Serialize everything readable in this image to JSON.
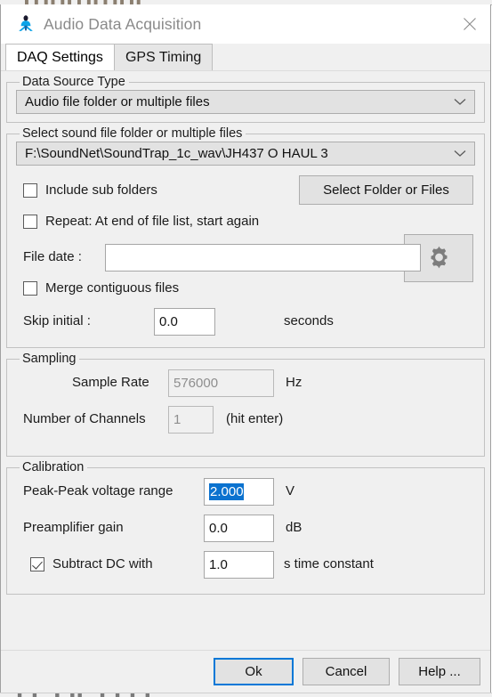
{
  "window": {
    "title": "Audio Data Acquisition",
    "icon": "duke-figure-icon",
    "close_icon": "close-icon"
  },
  "tabs": [
    {
      "label": "DAQ Settings",
      "active": true
    },
    {
      "label": "GPS Timing",
      "active": false
    }
  ],
  "data_source_type": {
    "legend": "Data Source Type",
    "selected": "Audio file folder or multiple files"
  },
  "select_sound_file": {
    "legend": "Select sound file folder or multiple files",
    "path": "F:\\SoundNet\\SoundTrap_1c_wav\\JH437 O HAUL 3",
    "include_sub_folders": {
      "label": "Include sub folders",
      "checked": false
    },
    "select_folder_button": "Select Folder or Files",
    "repeat": {
      "label": "Repeat: At end of file list, start again",
      "checked": false
    },
    "file_date": {
      "label": "File date :",
      "value": "",
      "placeholder": ""
    },
    "file_date_settings_icon": "gear-icon",
    "merge_contiguous": {
      "label": "Merge contiguous files",
      "checked": false
    },
    "skip_initial": {
      "label": "Skip initial :",
      "value": "0.0",
      "units": "seconds"
    }
  },
  "sampling": {
    "legend": "Sampling",
    "sample_rate": {
      "label": "Sample Rate",
      "value": "576000",
      "units": "Hz",
      "disabled": true
    },
    "channels": {
      "label": "Number of Channels",
      "value": "1",
      "hint": "(hit enter)",
      "disabled": true
    }
  },
  "calibration": {
    "legend": "Calibration",
    "peak_peak": {
      "label": "Peak-Peak voltage range",
      "value": "2.000",
      "units": "V",
      "selected": true
    },
    "preamp_gain": {
      "label": "Preamplifier gain",
      "value": "0.0",
      "units": "dB"
    },
    "subtract_dc": {
      "label": "Subtract DC with",
      "checked": true,
      "value": "1.0",
      "units": "s time constant"
    }
  },
  "footer": {
    "ok": "Ok",
    "cancel": "Cancel",
    "help": "Help ..."
  },
  "colors": {
    "accent": "#0078d7",
    "selection": "#0b72cf",
    "panel": "#f0f0f0",
    "control": "#e2e2e2",
    "border": "#a0a0a0"
  },
  "background_ghost": {
    "top": "▌ ▌ ▌▌ ▌▌ ▌ ▌▌ ▌ ▌▌ ▌▌",
    "bottom": "▖▘▖▘▘▖▘▖▖▘▘▖▘▖▘▖▘▖▘"
  }
}
